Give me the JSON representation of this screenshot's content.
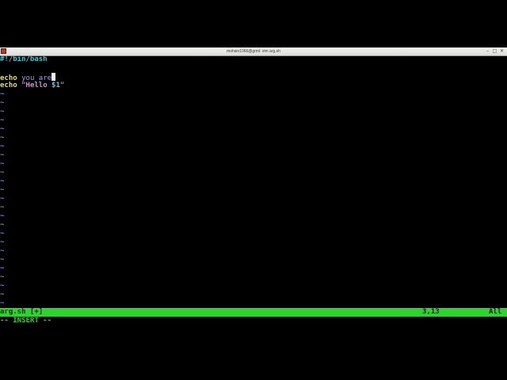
{
  "window": {
    "title": "mohsin1066@grml: vim arg.sh",
    "buttons": {
      "minimize": "‒",
      "maximize": "□",
      "close": "✕"
    }
  },
  "editor": {
    "line1": "#!/bin/bash",
    "line3_kw": "echo",
    "line3_text": " you are",
    "line4_kw": "echo",
    "line4_str_open": " \"Hello ",
    "line4_var": "$1",
    "line4_str_close": "\"",
    "tilde": "~"
  },
  "status": {
    "filename": "arg.sh [+]",
    "position": "3,13",
    "scroll": "All",
    "mode": "-- INSERT --"
  },
  "colors": {
    "status_bg": "#2ad62a",
    "tilde": "#6f83d9",
    "background": "#000000"
  }
}
